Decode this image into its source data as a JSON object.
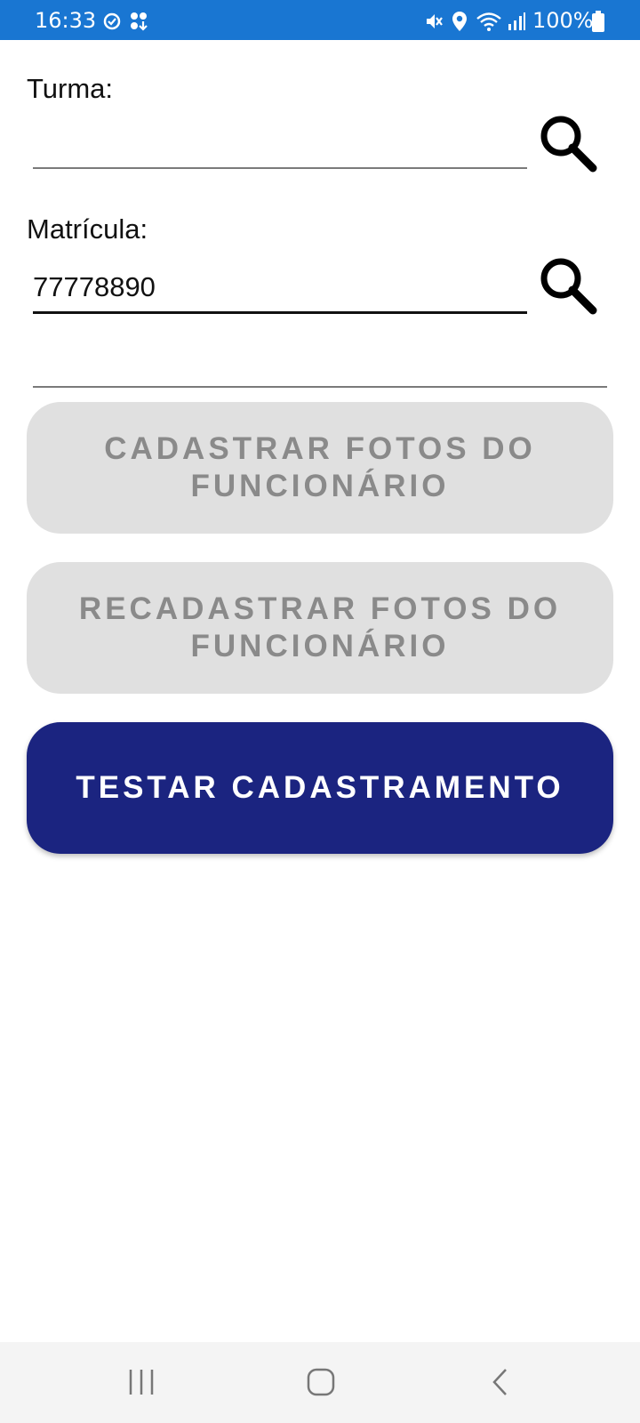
{
  "status_bar": {
    "time": "16:33",
    "battery": "100%",
    "icons": [
      "sync-icon",
      "app-notification-icon",
      "mute-icon",
      "location-icon",
      "wifi-icon",
      "signal-icon",
      "battery-icon"
    ]
  },
  "form": {
    "turma_label": "Turma:",
    "turma_value": "",
    "matricula_label": "Matrícula:",
    "matricula_value": "77778890",
    "extra_value": ""
  },
  "buttons": {
    "cadastrar": "CADASTRAR FOTOS DO FUNCIONÁRIO",
    "recadastrar": "RECADASTRAR FOTOS DO FUNCIONÁRIO",
    "testar": "TESTAR CADASTRAMENTO"
  },
  "colors": {
    "status_bar": "#1976d2",
    "primary_button": "#1b2480",
    "disabled_button": "#e0e0e0",
    "disabled_text": "#8a8a8a"
  },
  "nav_bar": {
    "icons": [
      "recent-apps-icon",
      "home-icon",
      "back-icon"
    ]
  }
}
